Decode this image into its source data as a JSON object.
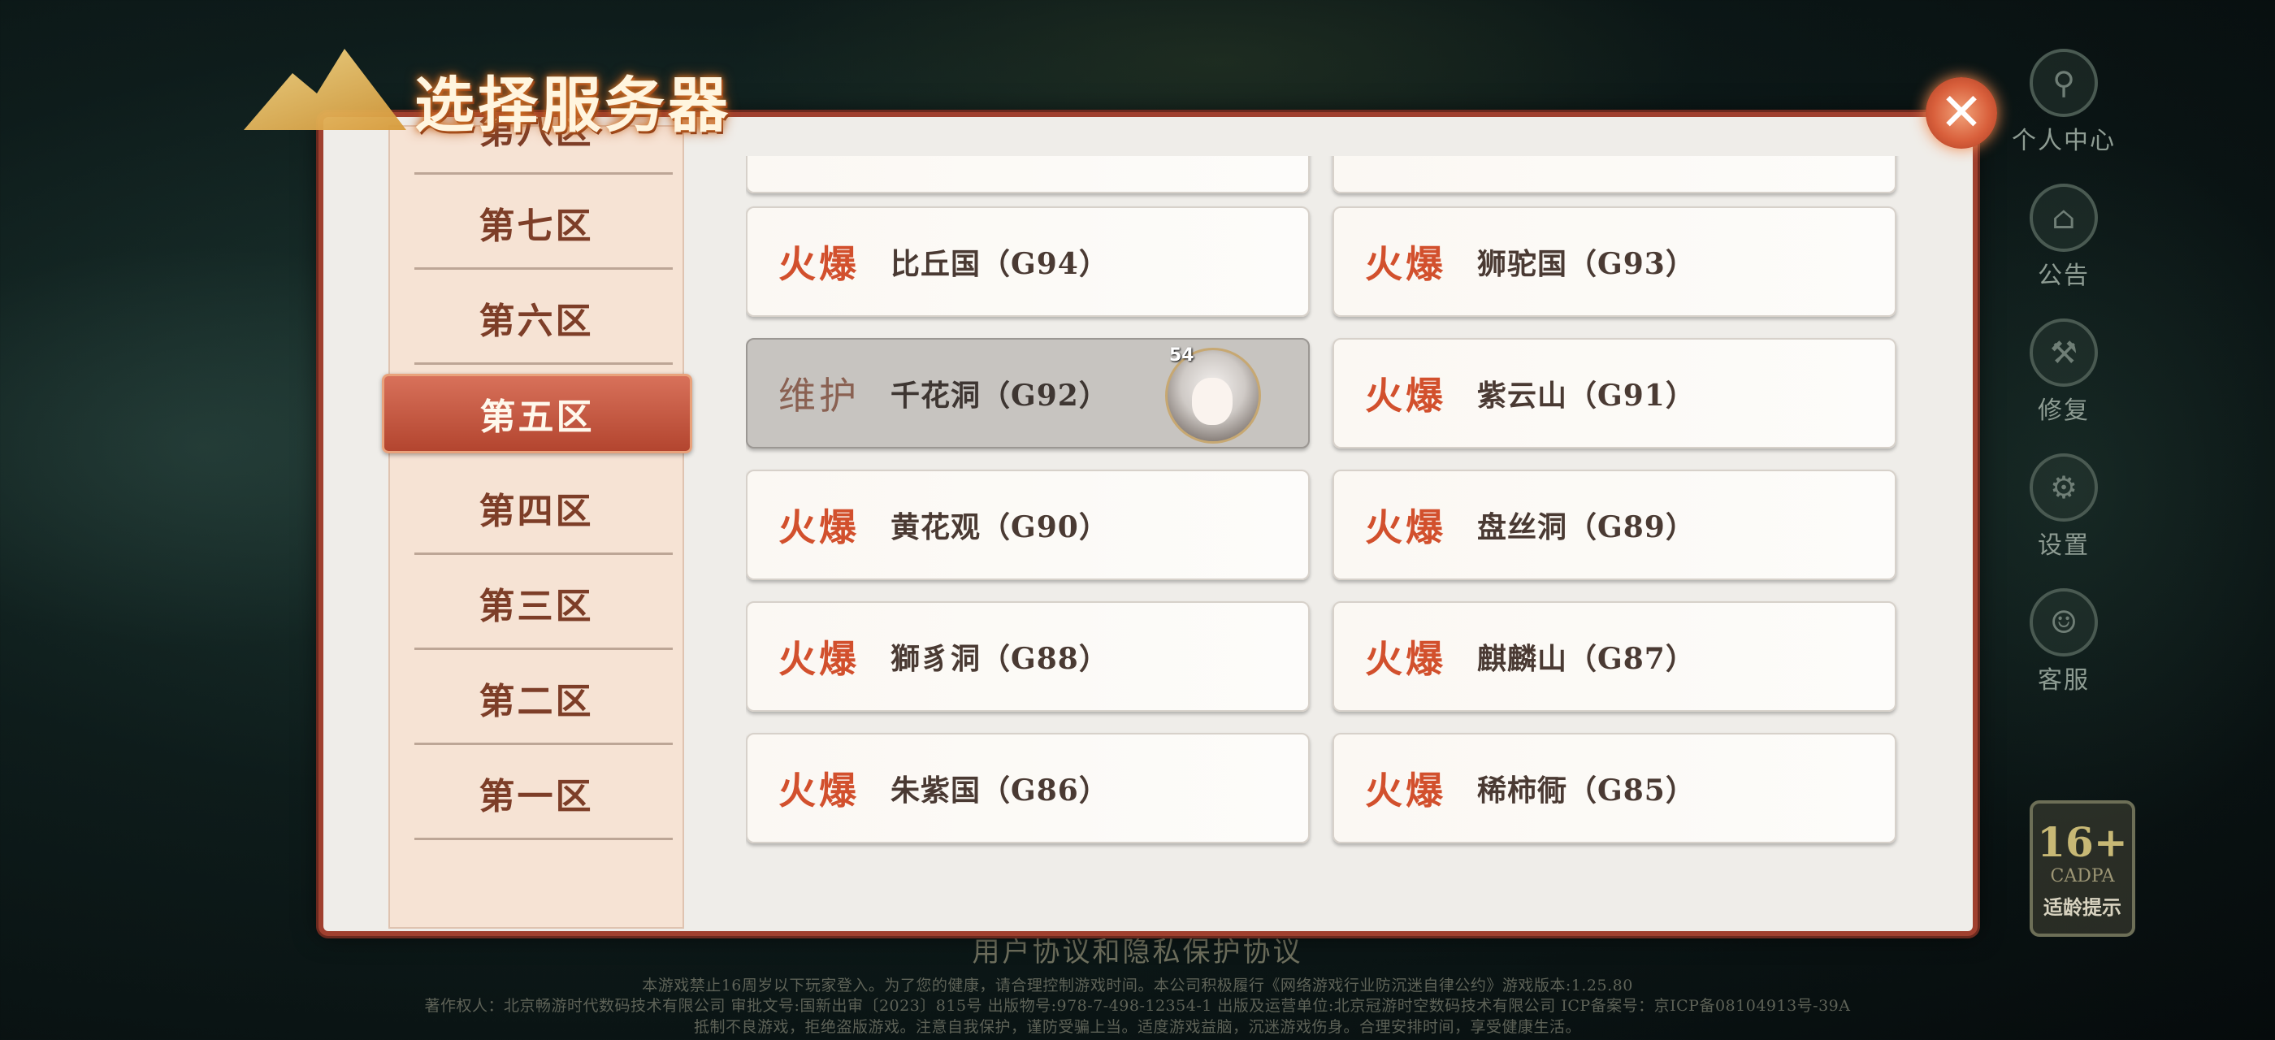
{
  "dialog": {
    "title": "选择服务器",
    "close_label": "✕"
  },
  "zones": [
    {
      "label": "第八区"
    },
    {
      "label": "第七区"
    },
    {
      "label": "第六区"
    },
    {
      "label": "第五区",
      "selected": true
    },
    {
      "label": "第四区"
    },
    {
      "label": "第三区"
    },
    {
      "label": "第二区"
    },
    {
      "label": "第一区"
    }
  ],
  "servers": [
    {
      "status": "火爆",
      "name": "比丘国（G94）"
    },
    {
      "status": "火爆",
      "name": "狮驼国（G93）"
    },
    {
      "status": "维护",
      "name": "千花洞（G92）",
      "avatar_level": "54"
    },
    {
      "status": "火爆",
      "name": "紫云山（G91）"
    },
    {
      "status": "火爆",
      "name": "黄花观（G90）"
    },
    {
      "status": "火爆",
      "name": "盘丝洞（G89）"
    },
    {
      "status": "火爆",
      "name": "獅豸洞（G88）"
    },
    {
      "status": "火爆",
      "name": "麒麟山（G87）"
    },
    {
      "status": "火爆",
      "name": "朱紫国（G86）"
    },
    {
      "status": "火爆",
      "name": "稀柿衕（G85）"
    }
  ],
  "side_menu": [
    {
      "label": "个人中心",
      "icon": "person-icon"
    },
    {
      "label": "公告",
      "icon": "notice-icon"
    },
    {
      "label": "修复",
      "icon": "repair-icon"
    },
    {
      "label": "设置",
      "icon": "gear-icon"
    },
    {
      "label": "客服",
      "icon": "support-icon"
    }
  ],
  "age_badge": {
    "age": "16+",
    "org": "CADPA",
    "tip": "适龄提示"
  },
  "footer": {
    "agreement": "用户协议和隐私保护协议",
    "line1": "本游戏禁止16周岁以下玩家登入。为了您的健康，请合理控制游戏时间。本公司积极履行《网络游戏行业防沉迷自律公约》游戏版本:1.25.80",
    "line2": "著作权人：北京畅游时代数码技术有限公司 审批文号:国新出审〔2023〕815号 出版物号:978-7-498-12354-1 出版及运营单位:北京冠游时空数码技术有限公司 ICP备案号：京ICP备08104913号-39A",
    "line3": "抵制不良游戏，拒绝盗版游戏。注意自我保护，谨防受骗上当。适度游戏益脑，沉迷游戏伤身。合理安排时间，享受健康生活。"
  },
  "colors": {
    "accent": "#b3452f",
    "hot_status": "#d2502d",
    "maintenance_status": "#8a6152"
  }
}
